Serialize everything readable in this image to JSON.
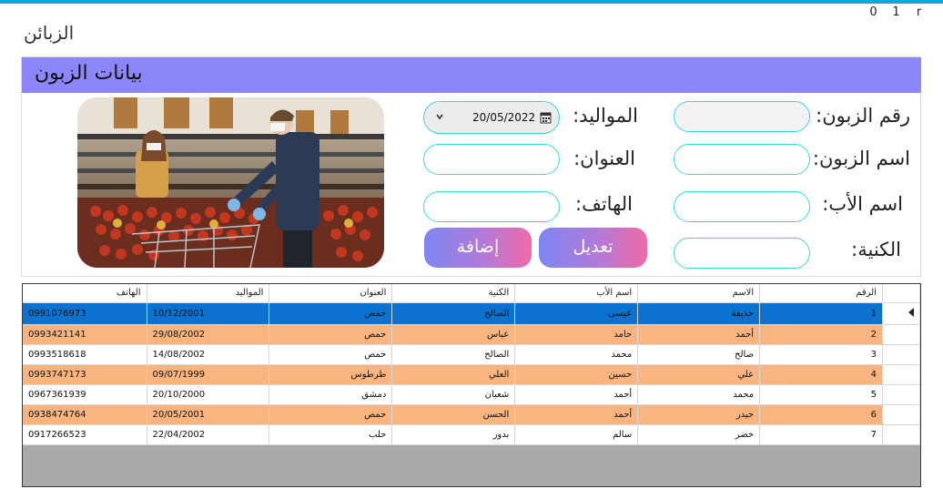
{
  "window": {
    "title": "الزبائن",
    "controls": [
      "0",
      "1",
      "r"
    ]
  },
  "panel": {
    "title": "بيانات الزبون",
    "header_color": "#8c86fa"
  },
  "form": {
    "customer_no_label": "رقم الزبون:",
    "customer_name_label": "اسم الزبون:",
    "father_name_label": "اسم الأب:",
    "nickname_label": "الكنية:",
    "birth_label": "المواليد:",
    "address_label": "العنوان:",
    "phone_label": "الهاتف:",
    "birth_value": "20/05/2022",
    "customer_no_value": "",
    "customer_name_value": "",
    "father_name_value": "",
    "nickname_value": "",
    "address_value": "",
    "phone_value": ""
  },
  "buttons": {
    "edit_label": "تعديل",
    "add_label": "إضافة"
  },
  "grid": {
    "columns": [
      "الرقم",
      "الاسم",
      "اسم الأب",
      "الكنية",
      "العنوان",
      "المواليد",
      "الهاتف"
    ],
    "rows": [
      [
        "1",
        "حذيفة",
        "عيسى",
        "الصالح",
        "حمص",
        "10/12/2001",
        "0991076973"
      ],
      [
        "2",
        "أحمد",
        "حامد",
        "عباس",
        "حمص",
        "29/08/2002",
        "0993421141"
      ],
      [
        "3",
        "صالح",
        "محمد",
        "الصالح",
        "حمص",
        "14/08/2002",
        "0993518618"
      ],
      [
        "4",
        "علي",
        "حسين",
        "العلي",
        "طرطوس",
        "09/07/1999",
        "0993747173"
      ],
      [
        "5",
        "محمد",
        "أحمد",
        "شعبان",
        "دمشق",
        "20/10/2000",
        "0967361939"
      ],
      [
        "6",
        "حيدر",
        "أحمد",
        "الحسن",
        "حمص",
        "20/05/2001",
        "0938474764"
      ],
      [
        "7",
        "خضر",
        "سالم",
        "بدور",
        "حلب",
        "22/04/2002",
        "0917266523"
      ]
    ],
    "selected_row": 0,
    "selection_color": "#0b72d0",
    "alt_row_color": "#f9b47f"
  }
}
